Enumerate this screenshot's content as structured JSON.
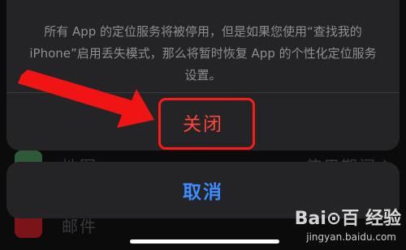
{
  "background": {
    "rows": [
      {
        "label": "地图",
        "value": "使用期间",
        "icon_color": "#2f5a3a"
      },
      {
        "label": "邮件",
        "value": "",
        "icon_color": "#7a1418"
      }
    ]
  },
  "action_sheet": {
    "message": "所有 App 的定位服务将被停用，但是如果您使用“查找我的iPhone”启用丢失模式，那么将暂时恢复 App 的个性化定位服务设置。",
    "destructive_label": "关闭",
    "cancel_label": "取消"
  },
  "watermark": {
    "brand": "Bai⊙百 经验",
    "url": "jingyan.baidu.com"
  },
  "colors": {
    "destructive": "#ff453a",
    "cancel": "#3d8cff",
    "annotation": "#ff1a1a"
  },
  "icons": [
    "red-arrow-annotation-icon",
    "chevron-right-icon",
    "baidu-paw-icon"
  ]
}
